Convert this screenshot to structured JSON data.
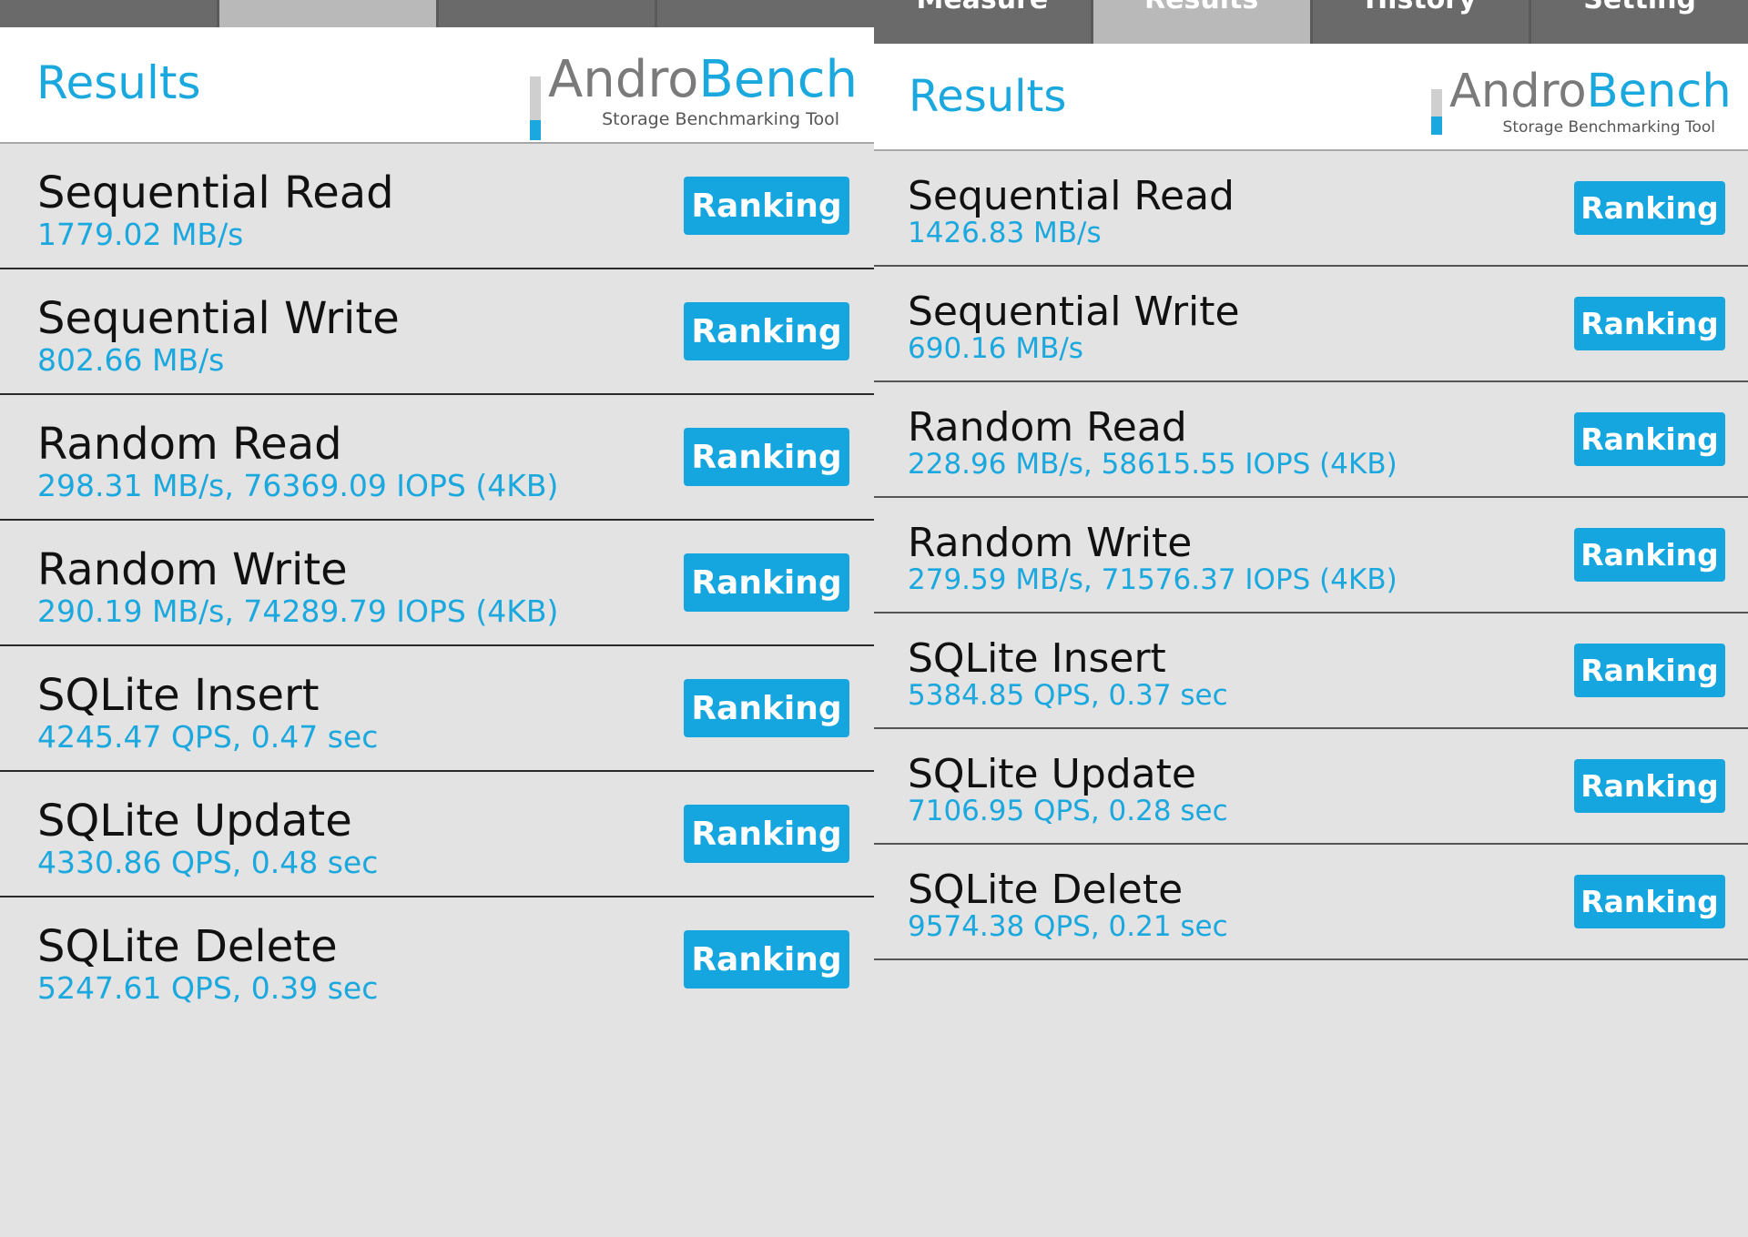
{
  "left": {
    "tabs": [
      {
        "label": ""
      },
      {
        "label": ""
      },
      {
        "label": ""
      },
      {
        "label": ""
      }
    ],
    "active_tab": 1,
    "header": {
      "title": "Results",
      "logo_part1": "Andro",
      "logo_part2": "Bench",
      "logo_subtitle": "Storage Benchmarking Tool"
    },
    "ranking_label": "Ranking",
    "results": [
      {
        "name": "Sequential Read",
        "value": "1779.02 MB/s"
      },
      {
        "name": "Sequential Write",
        "value": "802.66 MB/s"
      },
      {
        "name": "Random Read",
        "value": "298.31 MB/s, 76369.09 IOPS (4KB)"
      },
      {
        "name": "Random Write",
        "value": "290.19 MB/s, 74289.79 IOPS (4KB)"
      },
      {
        "name": "SQLite Insert",
        "value": "4245.47 QPS, 0.47 sec"
      },
      {
        "name": "SQLite Update",
        "value": "4330.86 QPS, 0.48 sec"
      },
      {
        "name": "SQLite Delete",
        "value": "5247.61 QPS, 0.39 sec"
      }
    ]
  },
  "right": {
    "tabs": [
      {
        "label": "Measure"
      },
      {
        "label": "Results"
      },
      {
        "label": "History"
      },
      {
        "label": "Setting"
      }
    ],
    "active_tab": 1,
    "header": {
      "title": "Results",
      "logo_part1": "Andro",
      "logo_part2": "Bench",
      "logo_subtitle": "Storage Benchmarking Tool"
    },
    "ranking_label": "Ranking",
    "results": [
      {
        "name": "Sequential Read",
        "value": "1426.83 MB/s"
      },
      {
        "name": "Sequential Write",
        "value": "690.16 MB/s"
      },
      {
        "name": "Random Read",
        "value": "228.96 MB/s, 58615.55 IOPS (4KB)"
      },
      {
        "name": "Random Write",
        "value": "279.59 MB/s, 71576.37 IOPS (4KB)"
      },
      {
        "name": "SQLite Insert",
        "value": "5384.85 QPS, 0.37 sec"
      },
      {
        "name": "SQLite Update",
        "value": "7106.95 QPS, 0.28 sec"
      },
      {
        "name": "SQLite Delete",
        "value": "9574.38 QPS, 0.21 sec"
      }
    ]
  },
  "colors": {
    "accent": "#1aa8de",
    "tab_bar": "#6a6a6a",
    "tab_active": "#b9b9b9",
    "list_background": "#e3e3e3"
  }
}
